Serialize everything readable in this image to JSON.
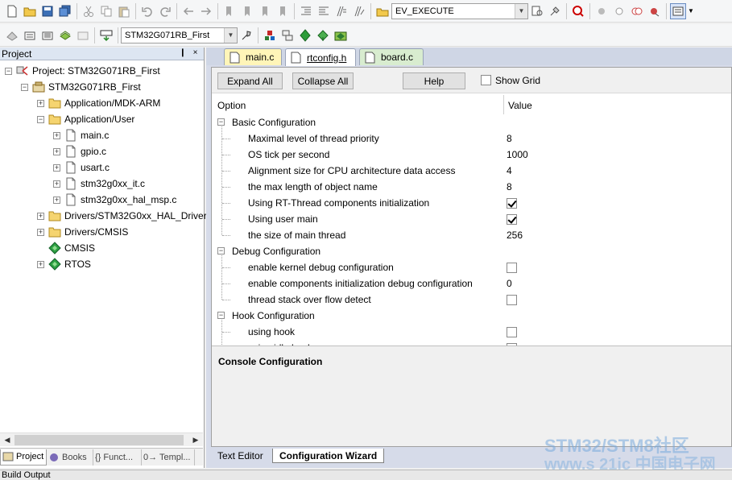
{
  "toolbar1": {
    "target_combo": "EV_EXECUTE"
  },
  "toolbar2": {
    "project_combo": "STM32G071RB_First"
  },
  "project_panel": {
    "title": "Project",
    "pin_glyph": "❙",
    "close_glyph": "×",
    "tree": [
      {
        "label": "Project: STM32G071RB_First",
        "icon": "project-icon",
        "expander": "−"
      },
      {
        "label": "STM32G071RB_First",
        "icon": "target-icon",
        "expander": "−"
      },
      {
        "label": "Application/MDK-ARM",
        "icon": "folder-icon",
        "expander": "+"
      },
      {
        "label": "Application/User",
        "icon": "folder-icon",
        "expander": "−"
      },
      {
        "label": "main.c",
        "icon": "file-icon",
        "expander": "+"
      },
      {
        "label": "gpio.c",
        "icon": "file-icon",
        "expander": "+"
      },
      {
        "label": "usart.c",
        "icon": "file-icon",
        "expander": "+"
      },
      {
        "label": "stm32g0xx_it.c",
        "icon": "file-icon",
        "expander": "+"
      },
      {
        "label": "stm32g0xx_hal_msp.c",
        "icon": "file-icon",
        "expander": "+"
      },
      {
        "label": "Drivers/STM32G0xx_HAL_Driver",
        "icon": "folder-icon",
        "expander": "+"
      },
      {
        "label": "Drivers/CMSIS",
        "icon": "folder-icon",
        "expander": "+"
      },
      {
        "label": "CMSIS",
        "icon": "component-icon",
        "expander": ""
      },
      {
        "label": "RTOS",
        "icon": "component-icon",
        "expander": "+"
      }
    ],
    "tabs": [
      {
        "label": "Project",
        "icon": "project-tab-icon"
      },
      {
        "label": "Books",
        "icon": "books-icon"
      },
      {
        "label": "{} Funct...",
        "icon": "functions-icon"
      },
      {
        "label": "0→ Templ...",
        "icon": "templates-icon"
      }
    ]
  },
  "file_tabs": [
    {
      "label": "main.c",
      "active": false
    },
    {
      "label": "rtconfig.h",
      "active": true
    },
    {
      "label": "board.c",
      "active": false
    }
  ],
  "wizard": {
    "expand_all": "Expand All",
    "collapse_all": "Collapse All",
    "help": "Help",
    "show_grid": "Show Grid",
    "col_option": "Option",
    "col_value": "Value",
    "groups": [
      {
        "label": "Basic Configuration",
        "items": [
          {
            "label": "Maximal level of thread priority",
            "value": "8",
            "type": "text"
          },
          {
            "label": "OS tick per second",
            "value": "1000",
            "type": "text"
          },
          {
            "label": "Alignment size for CPU architecture data access",
            "value": "4",
            "type": "text"
          },
          {
            "label": "the max length of object name",
            "value": "8",
            "type": "text"
          },
          {
            "label": "Using RT-Thread components initialization",
            "value": "checked",
            "type": "check"
          },
          {
            "label": "Using user main",
            "value": "checked",
            "type": "check"
          },
          {
            "label": "the size of main thread",
            "value": "256",
            "type": "text"
          }
        ]
      },
      {
        "label": "Debug Configuration",
        "items": [
          {
            "label": "enable kernel debug configuration",
            "value": "unchecked",
            "type": "check"
          },
          {
            "label": "enable components initialization debug configuration",
            "value": "0",
            "type": "text"
          },
          {
            "label": "thread stack over flow detect",
            "value": "unchecked",
            "type": "check"
          }
        ]
      },
      {
        "label": "Hook Configuration",
        "items": [
          {
            "label": "using hook",
            "value": "unchecked",
            "type": "check"
          },
          {
            "label": "using idle hook",
            "value": "unchecked",
            "type": "check"
          }
        ]
      }
    ],
    "description_title": "Console Configuration"
  },
  "editor_tabs": [
    {
      "label": "Text Editor",
      "active": false
    },
    {
      "label": "Configuration Wizard",
      "active": true
    }
  ],
  "watermark": {
    "line1": "STM32/STM8社区",
    "line2": "www.s 21ic 中国电子网"
  },
  "status_bar": {
    "text": "Build Output"
  }
}
